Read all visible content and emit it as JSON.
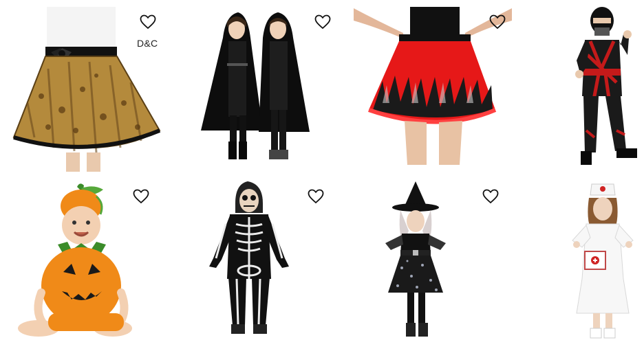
{
  "products": [
    {
      "name": "leopard-tutu-skirt",
      "favorite_icon": "heart-outline-icon",
      "brand": "D&C"
    },
    {
      "name": "black-hooded-cape",
      "favorite_icon": "heart-outline-icon"
    },
    {
      "name": "red-flame-tutu-skirt",
      "favorite_icon": "heart-outline-icon"
    },
    {
      "name": "red-ninja-costume"
    },
    {
      "name": "baby-pumpkin-costume",
      "favorite_icon": "heart-outline-icon"
    },
    {
      "name": "skeleton-jumpsuit-costume",
      "favorite_icon": "heart-outline-icon"
    },
    {
      "name": "witch-dress-costume",
      "favorite_icon": "heart-outline-icon"
    },
    {
      "name": "nurse-costume"
    }
  ],
  "colors": {
    "heart_stroke": "#111111",
    "background": "#ffffff"
  }
}
